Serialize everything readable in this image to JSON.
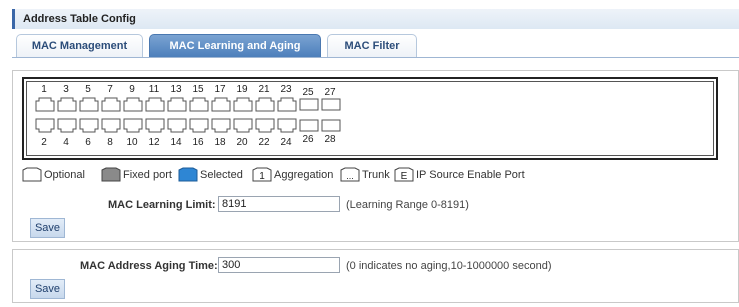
{
  "title": "Address Table Config",
  "tabs": [
    {
      "label": "MAC Management",
      "active": false
    },
    {
      "label": "MAC Learning and Aging",
      "active": true
    },
    {
      "label": "MAC Filter",
      "active": false
    }
  ],
  "ports": {
    "top_numbers": [
      "1",
      "3",
      "5",
      "7",
      "9",
      "11",
      "13",
      "15",
      "17",
      "19",
      "21",
      "23",
      "25",
      "27"
    ],
    "bottom_numbers": [
      "2",
      "4",
      "6",
      "8",
      "10",
      "12",
      "14",
      "16",
      "18",
      "20",
      "22",
      "24",
      "26",
      "28"
    ]
  },
  "legend": {
    "optional": "Optional",
    "fixed": "Fixed port",
    "selected": "Selected",
    "aggregation": "Aggregation",
    "aggregation_glyph": "1",
    "trunk": "Trunk",
    "trunk_glyph": "...",
    "ipsource": "IP Source Enable Port",
    "ipsource_glyph": "E"
  },
  "learning": {
    "label": "MAC Learning Limit:",
    "value": "8191",
    "hint": "(Learning Range 0-8191)",
    "save": "Save"
  },
  "aging": {
    "label": "MAC Address Aging Time:",
    "value": "300",
    "hint": "(0 indicates no aging,10-1000000 second)",
    "save": "Save"
  },
  "colors": {
    "accent": "#4d7fbb",
    "selected_port": "#2e86d4",
    "fixed_port": "#8a8a8a"
  }
}
